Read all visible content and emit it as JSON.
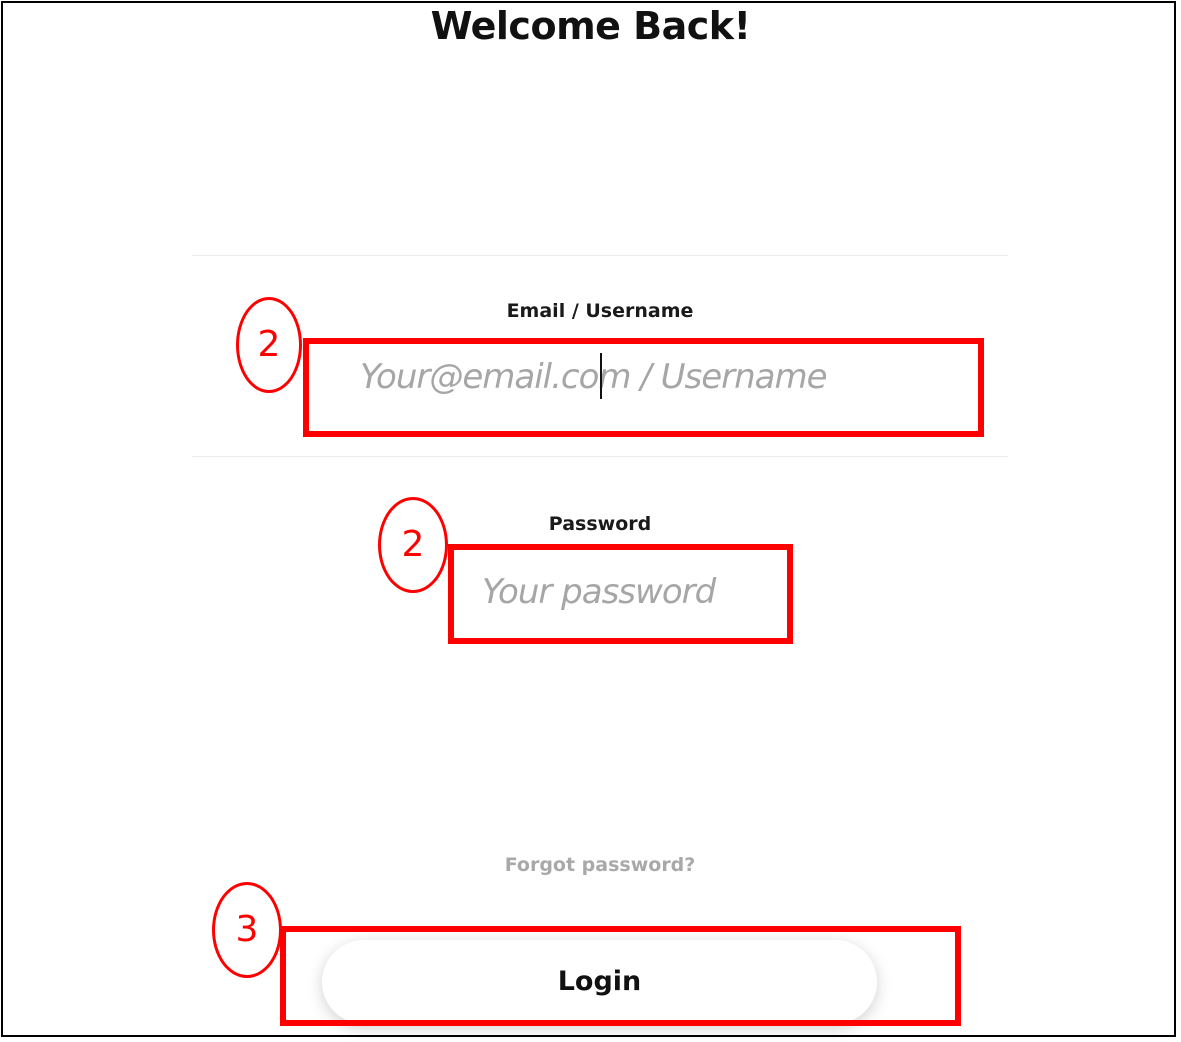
{
  "page": {
    "title": "Welcome Back!"
  },
  "login_form": {
    "email": {
      "label": "Email / Username",
      "placeholder": "Your@email.com / Username",
      "value": ""
    },
    "password": {
      "label": "Password",
      "placeholder": "Your password",
      "value": ""
    },
    "forgot_password_label": "Forgot password?",
    "login_label": "Login"
  },
  "annotations": {
    "color": "#ff0000",
    "markers": [
      {
        "label": "2",
        "target": "email-field"
      },
      {
        "label": "2",
        "target": "password-field"
      },
      {
        "label": "3",
        "target": "login-button"
      }
    ]
  }
}
